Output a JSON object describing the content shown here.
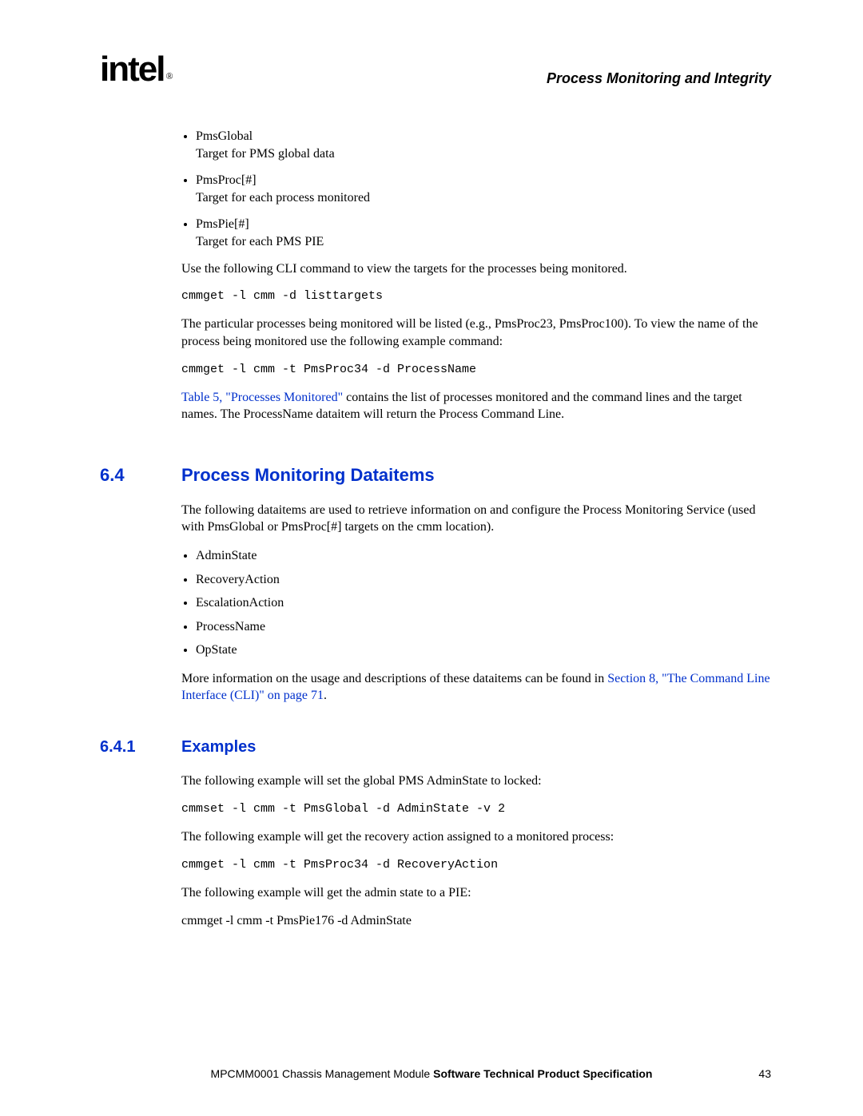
{
  "header": {
    "logo_text": "intel",
    "logo_reg": "®",
    "section_title": "Process Monitoring and Integrity"
  },
  "bullets_top": [
    {
      "name": "PmsGlobal",
      "desc": "Target for PMS global data"
    },
    {
      "name": "PmsProc[#]",
      "desc": "Target for each process monitored"
    },
    {
      "name": "PmsPie[#]",
      "desc": "Target for each PMS PIE"
    }
  ],
  "p1": "Use the following CLI command to view the targets for the processes being monitored.",
  "code1": "cmmget -l cmm -d listtargets",
  "p2": "The particular processes being monitored will be listed (e.g., PmsProc23, PmsProc100). To view the name of the process being monitored use the following example command:",
  "code2": "cmmget -l cmm -t PmsProc34 -d ProcessName",
  "p3_link": "Table 5, \"Processes Monitored\"",
  "p3_rest": " contains the list of processes monitored and the command lines and the target names. The ProcessName dataitem will return the Process Command Line.",
  "sec64": {
    "num": "6.4",
    "title": "Process Monitoring Dataitems"
  },
  "p4": "The following dataitems are used to retrieve information on and configure the Process Monitoring Service (used with PmsGlobal or PmsProc[#] targets on the cmm location).",
  "dataitems": [
    "AdminState",
    "RecoveryAction",
    "EscalationAction",
    "ProcessName",
    "OpState"
  ],
  "p5_before": "More information on the usage and descriptions of these dataitems can be found in ",
  "p5_link": "Section 8, \"The Command Line Interface (CLI)\" on page 71",
  "p5_after": ".",
  "sec641": {
    "num": "6.4.1",
    "title": "Examples"
  },
  "p6": "The following example will set the global PMS AdminState to locked:",
  "code3": "cmmset -l cmm -t PmsGlobal -d AdminState -v 2",
  "p7": "The following example will get the recovery action assigned to a monitored process:",
  "code4": "cmmget -l cmm -t PmsProc34 -d RecoveryAction",
  "p8": "The following example will get the admin state to a PIE:",
  "p9": "cmmget -l cmm -t PmsPie176 -d AdminState",
  "footer": {
    "prefix": "MPCMM0001 Chassis Management Module ",
    "bold": "Software Technical Product Specification",
    "page": "43"
  }
}
